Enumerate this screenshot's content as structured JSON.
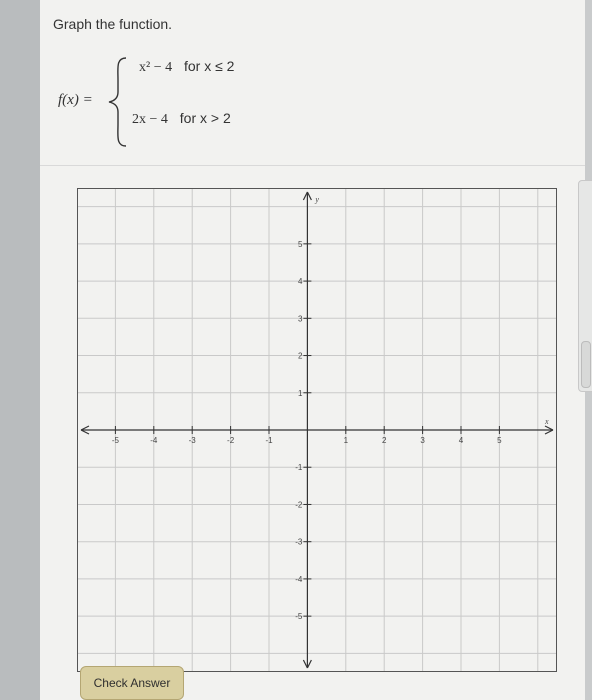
{
  "question": {
    "prompt": "Graph the function.",
    "function_name": "f(x) =",
    "cases": [
      {
        "expression": "x² − 4",
        "condition": "for x ≤ 2"
      },
      {
        "expression": "2x − 4",
        "condition": "for x > 2"
      }
    ]
  },
  "graph": {
    "x_axis_label": "x",
    "y_axis_label": "y",
    "x_min": -6,
    "x_max": 6.5,
    "y_min": -6.5,
    "y_max": 6.5,
    "x_tick_labels": [
      "-5",
      "-4",
      "-3",
      "-2",
      "-1",
      "1",
      "2",
      "3",
      "4",
      "5"
    ],
    "y_tick_labels": [
      "5",
      "4",
      "3",
      "2",
      "1",
      "-1",
      "-2",
      "-3",
      "-4",
      "-5"
    ],
    "gridlines": true
  },
  "actions": {
    "check_answer_label": "Check Answer"
  },
  "colors": {
    "button_fill": "#d9cfa0",
    "grid": "#c9c9c9",
    "axis": "#333333"
  }
}
